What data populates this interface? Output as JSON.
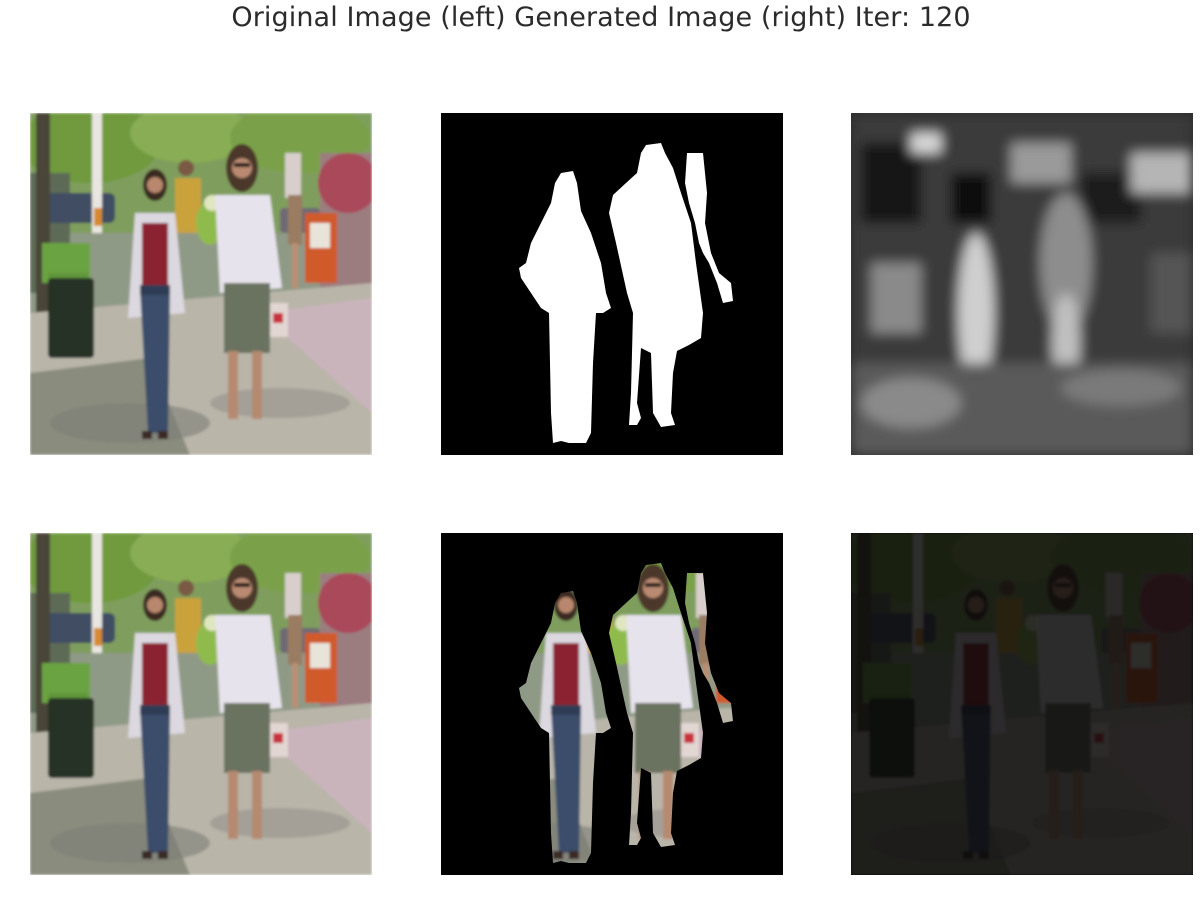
{
  "figure": {
    "title": "Original Image (left) Generated Image (right) Iter: 120"
  },
  "colors": {
    "background": "#ffffff",
    "title_text": "#2b2b2b",
    "mask_background": "#000000",
    "mask_foreground": "#ffffff",
    "dark_panel": "#0c0c0c"
  }
}
